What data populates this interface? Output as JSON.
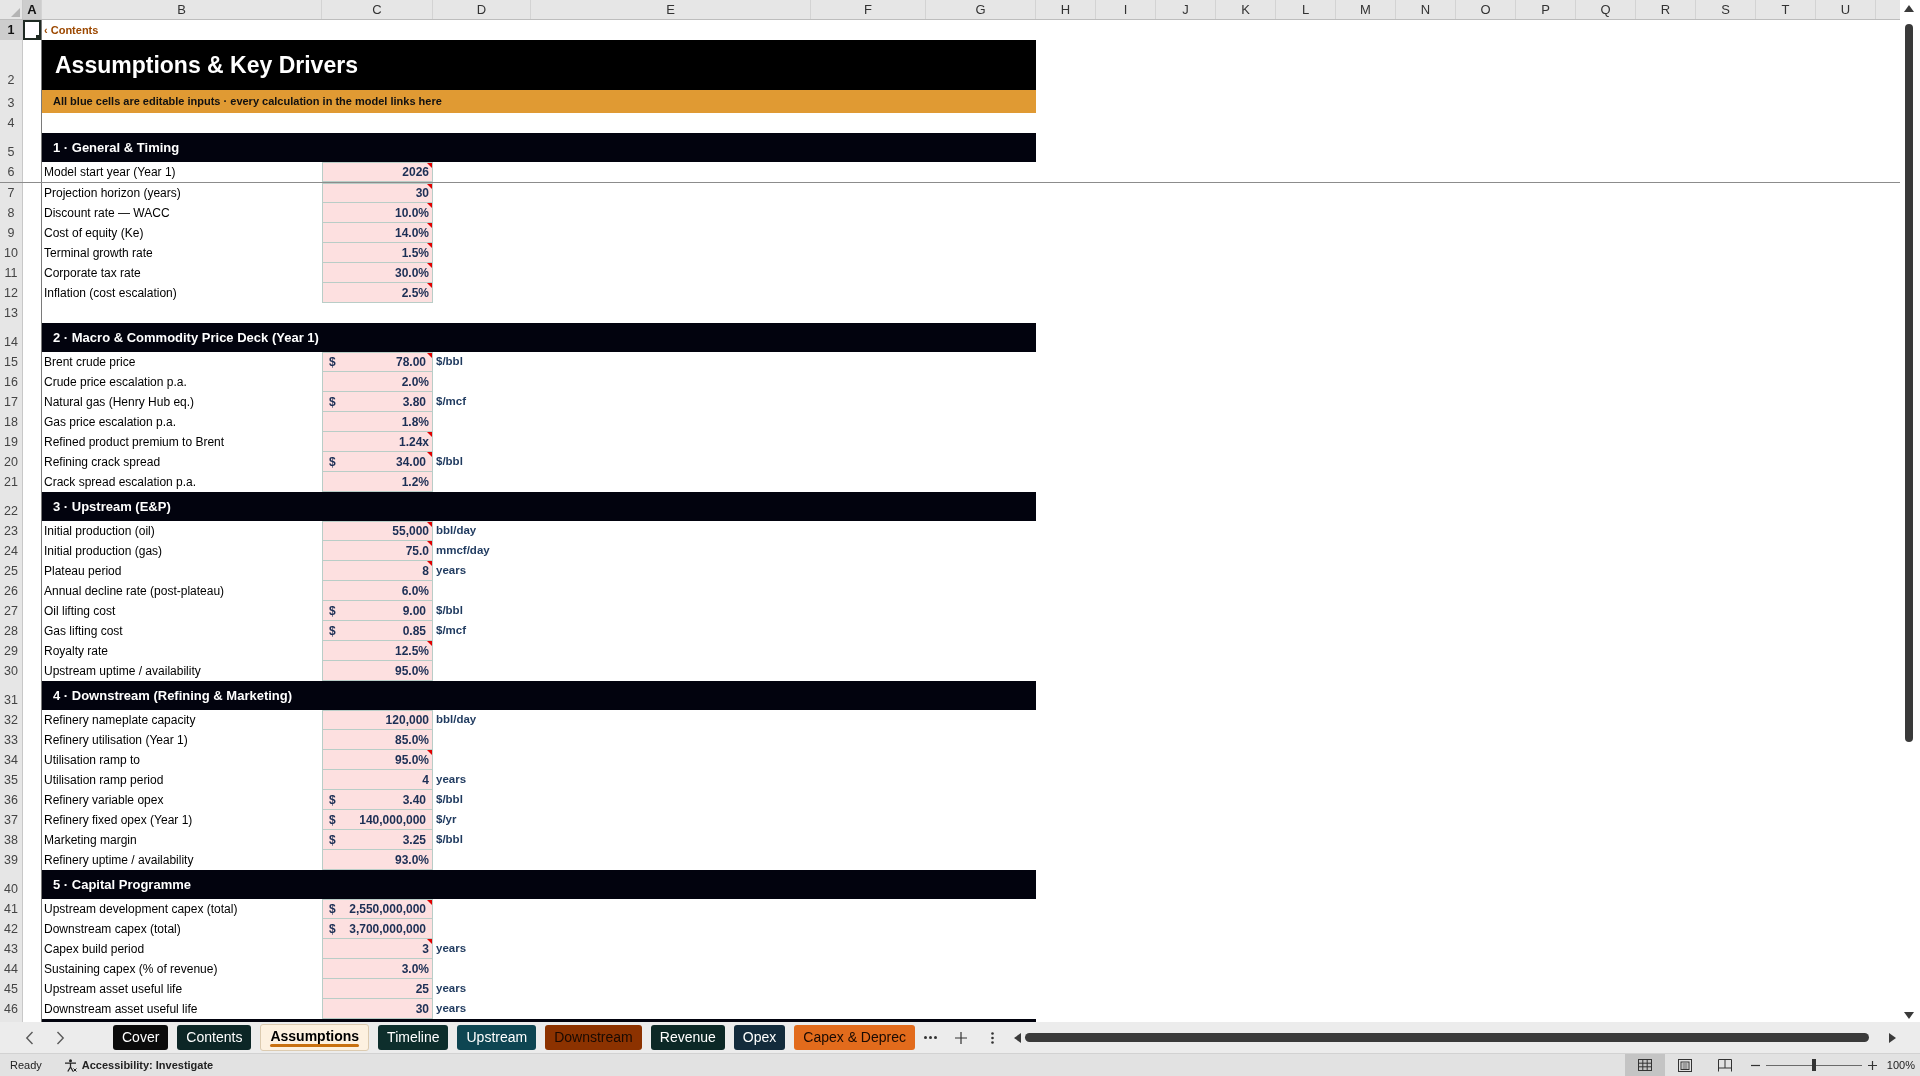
{
  "sheet": {
    "columns": [
      {
        "label": "A",
        "selected": true
      },
      {
        "label": "B",
        "selected": false
      },
      {
        "label": "C",
        "selected": false
      },
      {
        "label": "D",
        "selected": false
      },
      {
        "label": "E",
        "selected": false
      },
      {
        "label": "F",
        "selected": false
      },
      {
        "label": "G",
        "selected": false
      },
      {
        "label": "H",
        "selected": false
      },
      {
        "label": "I",
        "selected": false
      },
      {
        "label": "J",
        "selected": false
      },
      {
        "label": "K",
        "selected": false
      },
      {
        "label": "L",
        "selected": false
      },
      {
        "label": "M",
        "selected": false
      },
      {
        "label": "N",
        "selected": false
      },
      {
        "label": "O",
        "selected": false
      },
      {
        "label": "P",
        "selected": false
      },
      {
        "label": "Q",
        "selected": false
      },
      {
        "label": "R",
        "selected": false
      },
      {
        "label": "S",
        "selected": false
      },
      {
        "label": "T",
        "selected": false
      },
      {
        "label": "U",
        "selected": false
      }
    ],
    "frozen_rows": [
      {
        "number": "1",
        "selected": true,
        "kind": "link",
        "text": "‹ Contents"
      },
      {
        "number": "2",
        "selected": false,
        "kind": "title",
        "text": "Assumptions & Key Drivers"
      },
      {
        "number": "3",
        "selected": false,
        "kind": "banner",
        "text": "All blue cells are editable inputs · every calculation in the model links here"
      },
      {
        "number": "4",
        "selected": false,
        "kind": "blank"
      },
      {
        "number": "5",
        "selected": false,
        "kind": "section",
        "text": "1 · General & Timing"
      },
      {
        "number": "6",
        "selected": false,
        "kind": "input",
        "label": "Model start year (Year 1)",
        "value": "2026",
        "comment": true
      }
    ],
    "rows": [
      {
        "number": "7",
        "selected": false,
        "kind": "input",
        "label": "Projection horizon (years)",
        "value": "30",
        "comment": true
      },
      {
        "number": "8",
        "selected": false,
        "kind": "input",
        "label": "Discount rate — WACC",
        "value": "10.0%",
        "comment": true
      },
      {
        "number": "9",
        "selected": false,
        "kind": "input",
        "label": "Cost of equity (Ke)",
        "value": "14.0%",
        "comment": true
      },
      {
        "number": "10",
        "selected": false,
        "kind": "input",
        "label": "Terminal growth rate",
        "value": "1.5%",
        "comment": true
      },
      {
        "number": "11",
        "selected": false,
        "kind": "input",
        "label": "Corporate tax rate",
        "value": "30.0%",
        "comment": true
      },
      {
        "number": "12",
        "selected": false,
        "kind": "input",
        "label": "Inflation (cost escalation)",
        "value": "2.5%",
        "comment": true
      },
      {
        "number": "13",
        "selected": false,
        "kind": "blank"
      },
      {
        "number": "14",
        "selected": false,
        "kind": "section",
        "text": "2 · Macro & Commodity Price Deck (Year 1)"
      },
      {
        "number": "15",
        "selected": false,
        "kind": "input",
        "label": "Brent crude price",
        "currency": "$",
        "value": "78.00",
        "unit": "$/bbl",
        "comment": true
      },
      {
        "number": "16",
        "selected": false,
        "kind": "input",
        "label": "Crude price escalation p.a.",
        "value": "2.0%",
        "comment": false
      },
      {
        "number": "17",
        "selected": false,
        "kind": "input",
        "label": "Natural gas (Henry Hub eq.)",
        "currency": "$",
        "value": "3.80",
        "unit": "$/mcf",
        "comment": false
      },
      {
        "number": "18",
        "selected": false,
        "kind": "input",
        "label": "Gas price escalation p.a.",
        "value": "1.8%",
        "comment": false
      },
      {
        "number": "19",
        "selected": false,
        "kind": "input",
        "label": "Refined product premium to Brent",
        "value": "1.24x",
        "comment": true
      },
      {
        "number": "20",
        "selected": false,
        "kind": "input",
        "label": "Refining crack spread",
        "currency": "$",
        "value": "34.00",
        "unit": "$/bbl",
        "comment": true
      },
      {
        "number": "21",
        "selected": false,
        "kind": "input",
        "label": "Crack spread escalation p.a.",
        "value": "1.2%",
        "comment": false
      },
      {
        "number": "22",
        "selected": false,
        "kind": "section",
        "text": "3 · Upstream (E&P)"
      },
      {
        "number": "23",
        "selected": false,
        "kind": "input",
        "label": "Initial production (oil)",
        "value": "55,000",
        "unit": "bbl/day",
        "comment": true
      },
      {
        "number": "24",
        "selected": false,
        "kind": "input",
        "label": "Initial production (gas)",
        "value": "75.0",
        "unit": "mmcf/day",
        "comment": true
      },
      {
        "number": "25",
        "selected": false,
        "kind": "input",
        "label": "Plateau period",
        "value": "8",
        "unit": "years",
        "comment": true
      },
      {
        "number": "26",
        "selected": false,
        "kind": "input",
        "label": "Annual decline rate (post-plateau)",
        "value": "6.0%",
        "comment": false
      },
      {
        "number": "27",
        "selected": false,
        "kind": "input",
        "label": "Oil lifting cost",
        "currency": "$",
        "value": "9.00",
        "unit": "$/bbl",
        "comment": false
      },
      {
        "number": "28",
        "selected": false,
        "kind": "input",
        "label": "Gas lifting cost",
        "currency": "$",
        "value": "0.85",
        "unit": "$/mcf",
        "comment": false
      },
      {
        "number": "29",
        "selected": false,
        "kind": "input",
        "label": "Royalty rate",
        "value": "12.5%",
        "comment": true
      },
      {
        "number": "30",
        "selected": false,
        "kind": "input",
        "label": "Upstream uptime / availability",
        "value": "95.0%",
        "comment": false
      },
      {
        "number": "31",
        "selected": false,
        "kind": "section",
        "text": "4 · Downstream (Refining & Marketing)"
      },
      {
        "number": "32",
        "selected": false,
        "kind": "input",
        "label": "Refinery nameplate capacity",
        "value": "120,000",
        "unit": "bbl/day",
        "comment": false
      },
      {
        "number": "33",
        "selected": false,
        "kind": "input",
        "label": "Refinery utilisation (Year 1)",
        "value": "85.0%",
        "comment": false
      },
      {
        "number": "34",
        "selected": false,
        "kind": "input",
        "label": "Utilisation ramp to",
        "value": "95.0%",
        "comment": true
      },
      {
        "number": "35",
        "selected": false,
        "kind": "input",
        "label": "Utilisation ramp period",
        "value": "4",
        "unit": "years",
        "comment": false
      },
      {
        "number": "36",
        "selected": false,
        "kind": "input",
        "label": "Refinery variable opex",
        "currency": "$",
        "value": "3.40",
        "unit": "$/bbl",
        "comment": false
      },
      {
        "number": "37",
        "selected": false,
        "kind": "input",
        "label": "Refinery fixed opex (Year 1)",
        "currency": "$",
        "value": "140,000,000",
        "unit": "$/yr",
        "comment": false
      },
      {
        "number": "38",
        "selected": false,
        "kind": "input",
        "label": "Marketing margin",
        "currency": "$",
        "value": "3.25",
        "unit": "$/bbl",
        "comment": false
      },
      {
        "number": "39",
        "selected": false,
        "kind": "input",
        "label": "Refinery uptime / availability",
        "value": "93.0%",
        "comment": false
      },
      {
        "number": "40",
        "selected": false,
        "kind": "section",
        "text": "5 · Capital Programme"
      },
      {
        "number": "41",
        "selected": false,
        "kind": "input",
        "label": "Upstream development capex (total)",
        "currency": "$",
        "value": "2,550,000,000",
        "comment": true
      },
      {
        "number": "42",
        "selected": false,
        "kind": "input",
        "label": "Downstream capex (total)",
        "currency": "$",
        "value": "3,700,000,000",
        "comment": false
      },
      {
        "number": "43",
        "selected": false,
        "kind": "input",
        "label": "Capex build period",
        "value": "3",
        "unit": "years",
        "comment": true
      },
      {
        "number": "44",
        "selected": false,
        "kind": "input",
        "label": "Sustaining capex (% of revenue)",
        "value": "3.0%",
        "comment": false
      },
      {
        "number": "45",
        "selected": false,
        "kind": "input",
        "label": "Upstream asset useful life",
        "value": "25",
        "unit": "years",
        "comment": false
      },
      {
        "number": "46",
        "selected": false,
        "kind": "input",
        "label": "Downstream asset useful life",
        "value": "30",
        "unit": "years",
        "comment": false
      }
    ]
  },
  "sheet_tabs": [
    {
      "label": "Cover",
      "color": "#0b0b0b",
      "selected": false
    },
    {
      "label": "Contents",
      "color": "#0c2626",
      "selected": false
    },
    {
      "label": "Assumptions",
      "color": "#c8700f",
      "selected": true
    },
    {
      "label": "Timeline",
      "color": "#0d2e2c",
      "selected": false
    },
    {
      "label": "Upstream",
      "color": "#0e4552",
      "selected": false
    },
    {
      "label": "Downstream",
      "color": "#8c3200",
      "selected": false
    },
    {
      "label": "Revenue",
      "color": "#0c2826",
      "selected": false
    },
    {
      "label": "Opex",
      "color": "#132b3c",
      "selected": false
    },
    {
      "label": "Capex & Deprec",
      "color": "#e26b1c",
      "selected": false
    }
  ],
  "status_bar": {
    "status": "Ready",
    "accessibility": "Accessibility: Investigate",
    "views": [
      {
        "kind": "normal",
        "selected": true
      },
      {
        "kind": "page_layout",
        "selected": false
      },
      {
        "kind": "page_break",
        "selected": false
      }
    ],
    "zoom": {
      "level": 0.5,
      "reading": "100%"
    }
  }
}
